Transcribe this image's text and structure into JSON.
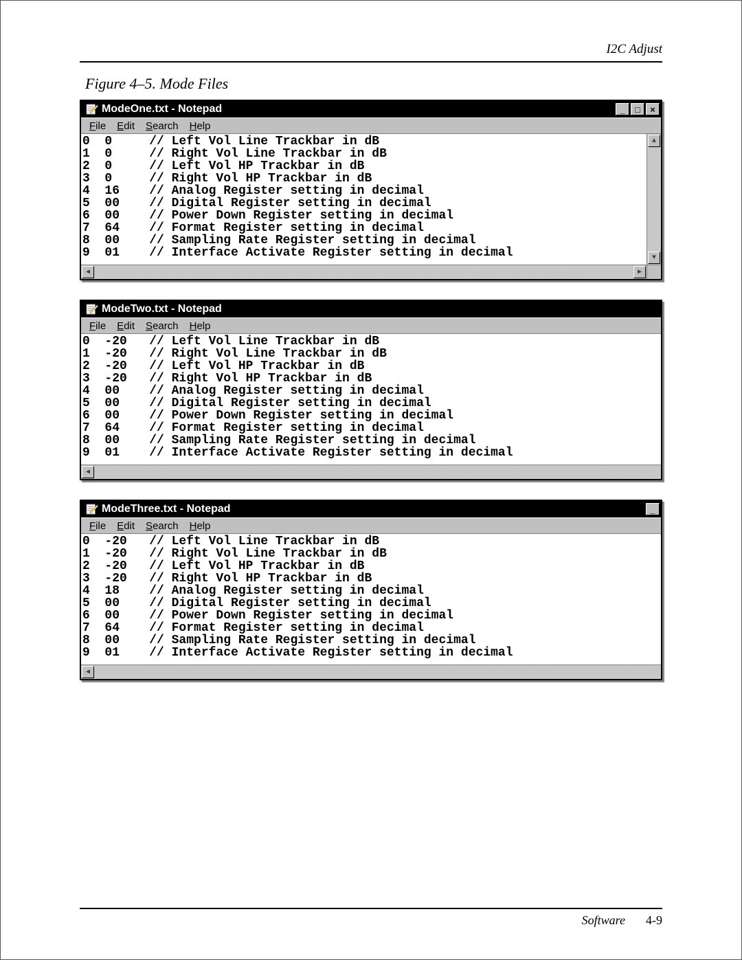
{
  "page": {
    "header": "I2C Adjust",
    "figure_caption": "Figure 4–5. Mode Files",
    "footer_section": "Software",
    "footer_page": "4-9"
  },
  "menus": {
    "file": "File",
    "edit": "Edit",
    "search": "Search",
    "help": "Help"
  },
  "win_buttons": {
    "minimize": "_",
    "maximize": "□",
    "close": "×"
  },
  "windows": [
    {
      "title": "ModeOne.txt - Notepad",
      "has_win_buttons": true,
      "has_vscroll": true,
      "has_sizegrip": true,
      "rows": [
        {
          "idx": "0",
          "val": "0",
          "comment": "// Left Vol Line Trackbar in dB"
        },
        {
          "idx": "1",
          "val": "0",
          "comment": "// Right Vol Line Trackbar in dB"
        },
        {
          "idx": "2",
          "val": "0",
          "comment": "// Left Vol HP Trackbar in dB"
        },
        {
          "idx": "3",
          "val": "0",
          "comment": "// Right Vol HP Trackbar in dB"
        },
        {
          "idx": "4",
          "val": "16",
          "comment": "// Analog Register setting in decimal"
        },
        {
          "idx": "5",
          "val": "00",
          "comment": "// Digital Register setting in decimal"
        },
        {
          "idx": "6",
          "val": "00",
          "comment": "// Power Down Register setting in decimal"
        },
        {
          "idx": "7",
          "val": "64",
          "comment": "// Format Register setting in decimal"
        },
        {
          "idx": "8",
          "val": "00",
          "comment": "// Sampling Rate Register setting in decimal"
        },
        {
          "idx": "9",
          "val": "01",
          "comment": "// Interface Activate Register setting in decimal"
        }
      ]
    },
    {
      "title": "ModeTwo.txt - Notepad",
      "has_win_buttons": false,
      "has_vscroll": false,
      "has_sizegrip": false,
      "rows": [
        {
          "idx": "0",
          "val": "-20",
          "comment": "// Left Vol Line Trackbar in dB"
        },
        {
          "idx": "1",
          "val": "-20",
          "comment": "// Right Vol Line Trackbar in dB"
        },
        {
          "idx": "2",
          "val": "-20",
          "comment": "// Left Vol HP Trackbar in dB"
        },
        {
          "idx": "3",
          "val": "-20",
          "comment": "// Right Vol HP Trackbar in dB"
        },
        {
          "idx": "4",
          "val": "00",
          "comment": "// Analog Register setting in decimal"
        },
        {
          "idx": "5",
          "val": "00",
          "comment": "// Digital Register setting in decimal"
        },
        {
          "idx": "6",
          "val": "00",
          "comment": "// Power Down Register setting in decimal"
        },
        {
          "idx": "7",
          "val": "64",
          "comment": "// Format Register setting in decimal"
        },
        {
          "idx": "8",
          "val": "00",
          "comment": "// Sampling Rate Register setting in decimal"
        },
        {
          "idx": "9",
          "val": "01",
          "comment": "// Interface Activate Register setting in decimal"
        }
      ]
    },
    {
      "title": "ModeThree.txt - Notepad",
      "has_win_buttons": "minimize-only",
      "has_vscroll": false,
      "has_sizegrip": false,
      "rows": [
        {
          "idx": "0",
          "val": "-20",
          "comment": "// Left Vol Line Trackbar in dB"
        },
        {
          "idx": "1",
          "val": "-20",
          "comment": "// Right Vol Line Trackbar in dB"
        },
        {
          "idx": "2",
          "val": "-20",
          "comment": "// Left Vol HP Trackbar in dB"
        },
        {
          "idx": "3",
          "val": "-20",
          "comment": "// Right Vol HP Trackbar in dB"
        },
        {
          "idx": "4",
          "val": "18",
          "comment": "// Analog Register setting in decimal"
        },
        {
          "idx": "5",
          "val": "00",
          "comment": "// Digital Register setting in decimal"
        },
        {
          "idx": "6",
          "val": "00",
          "comment": "// Power Down Register setting in decimal"
        },
        {
          "idx": "7",
          "val": "64",
          "comment": "// Format Register setting in decimal"
        },
        {
          "idx": "8",
          "val": "00",
          "comment": "// Sampling Rate Register setting in decimal"
        },
        {
          "idx": "9",
          "val": "01",
          "comment": "// Interface Activate Register setting in decimal"
        }
      ]
    }
  ]
}
